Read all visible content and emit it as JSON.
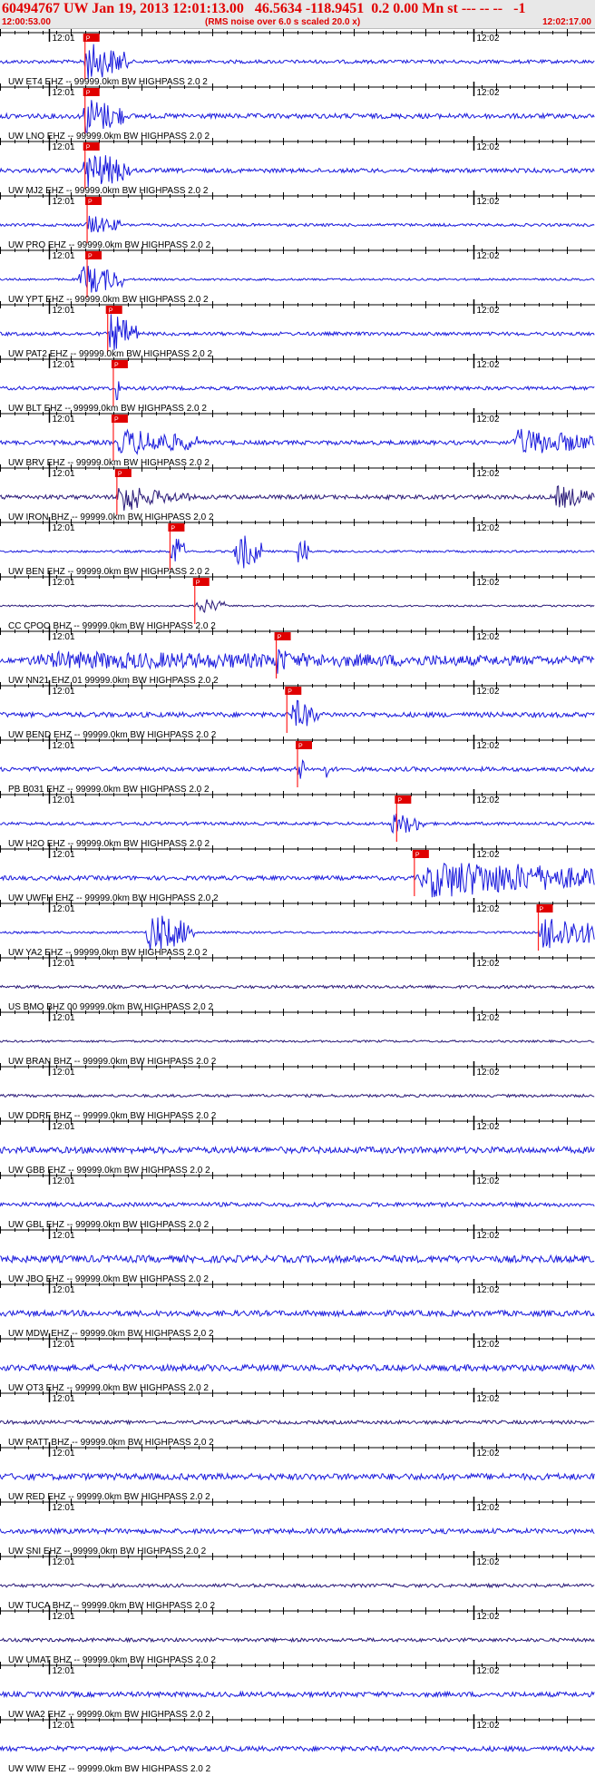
{
  "header": {
    "title": "60494767 UW Jan 19, 2013 12:01:13.00   46.5634 -118.9451  0.2 0.00 Mn st --- -- --   -1",
    "start_time": "12:00:53.00",
    "note": "(RMS noise over 6.0 s scaled 20.0 x)",
    "end_time": "12:02:17.00"
  },
  "chart_data": {
    "type": "seismogram",
    "time_window": {
      "start": "12:00:53.00",
      "end": "12:02:17.00"
    },
    "time_ticks": [
      "12:01",
      "12:02"
    ],
    "pick_label": "P",
    "traces": [
      {
        "label": "UW ET4 EHZ -- 99999.0km BW  HIGHPASS  2.0  2",
        "pick": 12.0,
        "color": "#1a1adc",
        "noise": 0.25,
        "bursts": [
          [
            11.5,
            18.0,
            1.0
          ]
        ]
      },
      {
        "label": "UW LNO EHZ -- 99999.0km BW  HIGHPASS  2.0  2",
        "pick": 12.0,
        "color": "#1a1adc",
        "noise": 0.35,
        "bursts": [
          [
            11.5,
            17.5,
            1.0
          ]
        ]
      },
      {
        "label": "UW MJ2 EHZ -- 99999.0km BW  HIGHPASS  2.0  2",
        "pick": 12.0,
        "color": "#1a1adc",
        "noise": 0.3,
        "bursts": [
          [
            11.5,
            18.5,
            1.0
          ]
        ]
      },
      {
        "label": "UW PRO EHZ -- 99999.0km BW  HIGHPASS  2.0  2",
        "pick": 12.3,
        "color": "#1a1adc",
        "noise": 0.2,
        "bursts": [
          [
            12.0,
            17.0,
            0.5
          ]
        ]
      },
      {
        "label": "UW YPT EHZ -- 99999.0km BW  HIGHPASS  2.0  2",
        "pick": 12.3,
        "color": "#1a1adc",
        "noise": 0.15,
        "bursts": [
          [
            11.0,
            17.5,
            0.8
          ]
        ]
      },
      {
        "label": "UW PAT2 EHZ -- 99999.0km BW  HIGHPASS  2.0  2",
        "pick": 15.2,
        "color": "#1a1adc",
        "noise": 0.25,
        "bursts": [
          [
            15.2,
            19.5,
            1.0
          ]
        ]
      },
      {
        "label": "UW BLT EHZ -- 99999.0km BW  HIGHPASS  2.0  2",
        "pick": 16.0,
        "color": "#1a1adc",
        "noise": 0.25,
        "bursts": [
          [
            16.3,
            17.0,
            1.0
          ]
        ]
      },
      {
        "label": "UW BRV EHZ -- 99999.0km BW  HIGHPASS  2.0  2",
        "pick": 16.0,
        "color": "#1a1adc",
        "noise": 0.3,
        "bursts": [
          [
            16.0,
            28.0,
            0.7
          ],
          [
            72.0,
            84.0,
            0.7
          ]
        ]
      },
      {
        "label": "UW IRON BHZ -- 99999.0km BW  HIGHPASS  2.0  2",
        "pick": 16.5,
        "color": "#2a1a78",
        "noise": 0.3,
        "bursts": [
          [
            16.5,
            20.0,
            1.0
          ],
          [
            20.0,
            27.0,
            0.4
          ],
          [
            78.0,
            84.0,
            0.6
          ]
        ]
      },
      {
        "label": "UW BEN EHZ -- 99999.0km BW  HIGHPASS  2.0  2",
        "pick": 24.0,
        "color": "#1a1adc",
        "noise": 0.15,
        "bursts": [
          [
            24.0,
            26.0,
            1.0
          ],
          [
            33.0,
            37.0,
            1.0
          ],
          [
            42.0,
            43.5,
            1.0
          ]
        ]
      },
      {
        "label": "CC CPOO BHZ -- 99999.0km BW  HIGHPASS  2.0  2",
        "pick": 27.5,
        "color": "#2a1a78",
        "noise": 0.12,
        "bursts": [
          [
            27.5,
            32.0,
            0.4
          ]
        ]
      },
      {
        "label": "UW NN21 EHZ 01 99999.0km BW  HIGHPASS  2.0  2",
        "pick": 39.0,
        "color": "#1a1adc",
        "noise": 0.3,
        "bursts": [
          [
            0.0,
            84.0,
            0.45
          ],
          [
            39.0,
            41.0,
            0.8
          ]
        ]
      },
      {
        "label": "UW BEND EHZ -- 99999.0km BW  HIGHPASS  2.0  2",
        "pick": 40.5,
        "color": "#1a1adc",
        "noise": 0.35,
        "bursts": [
          [
            41.0,
            45.0,
            0.8
          ]
        ]
      },
      {
        "label": "PB B031 EHZ -- 99999.0km BW  HIGHPASS  2.0  2",
        "pick": 42.0,
        "color": "#1a1adc",
        "noise": 0.3,
        "bursts": [
          [
            42.0,
            43.0,
            1.0
          ],
          [
            46.0,
            46.5,
            0.8
          ]
        ]
      },
      {
        "label": "UW H2O EHZ -- 99999.0km BW  HIGHPASS  2.0  2",
        "pick": 56.0,
        "color": "#1a1adc",
        "noise": 0.22,
        "bursts": [
          [
            55.0,
            60.0,
            0.6
          ]
        ]
      },
      {
        "label": "UW UWFH EHZ -- 99999.0km BW  HIGHPASS  2.0  2",
        "pick": 58.5,
        "color": "#1a1adc",
        "noise": 0.3,
        "bursts": [
          [
            58.5,
            84.0,
            1.0
          ]
        ]
      },
      {
        "label": "UW YA2 EHZ -- 99999.0km BW  HIGHPASS  2.0  2",
        "pick": 76.0,
        "color": "#1a1adc",
        "noise": 0.15,
        "bursts": [
          [
            20.5,
            27.5,
            1.0
          ],
          [
            76.0,
            84.0,
            1.0
          ]
        ]
      },
      {
        "label": "US BMO BHZ 00 99999.0km BW  HIGHPASS  2.0  2",
        "pick": null,
        "color": "#2a1a78",
        "noise": 0.22,
        "bursts": []
      },
      {
        "label": "UW BRAN BHZ -- 99999.0km BW  HIGHPASS  2.0  2",
        "pick": null,
        "color": "#2a1a78",
        "noise": 0.15,
        "bursts": []
      },
      {
        "label": "UW DDRF BHZ -- 99999.0km BW  HIGHPASS  2.0  2",
        "pick": null,
        "color": "#2a1a78",
        "noise": 0.2,
        "bursts": []
      },
      {
        "label": "UW GBB EHZ -- 99999.0km BW  HIGHPASS  2.0  2",
        "pick": null,
        "color": "#1a1adc",
        "noise": 0.45,
        "bursts": []
      },
      {
        "label": "UW GBL EHZ -- 99999.0km BW  HIGHPASS  2.0  2",
        "pick": null,
        "color": "#1a1adc",
        "noise": 0.3,
        "bursts": []
      },
      {
        "label": "UW JBO EHZ -- 99999.0km BW  HIGHPASS  2.0  2",
        "pick": null,
        "color": "#1a1adc",
        "noise": 0.5,
        "bursts": []
      },
      {
        "label": "UW MDW EHZ -- 99999.0km BW  HIGHPASS  2.0  2",
        "pick": null,
        "color": "#1a1adc",
        "noise": 0.4,
        "bursts": []
      },
      {
        "label": "UW OT3 EHZ -- 99999.0km BW  HIGHPASS  2.0  2",
        "pick": null,
        "color": "#1a1adc",
        "noise": 0.45,
        "bursts": []
      },
      {
        "label": "UW RATT BHZ -- 99999.0km BW  HIGHPASS  2.0  2",
        "pick": null,
        "color": "#2a1a78",
        "noise": 0.25,
        "bursts": []
      },
      {
        "label": "UW RED EHZ -- 99999.0km BW  HIGHPASS  2.0  2",
        "pick": null,
        "color": "#1a1adc",
        "noise": 0.45,
        "bursts": []
      },
      {
        "label": "UW SNI EHZ -- 99999.0km BW  HIGHPASS  2.0  2",
        "pick": null,
        "color": "#1a1adc",
        "noise": 0.35,
        "bursts": []
      },
      {
        "label": "UW TUCA BHZ -- 99999.0km BW  HIGHPASS  2.0  2",
        "pick": null,
        "color": "#2a1a78",
        "noise": 0.25,
        "bursts": []
      },
      {
        "label": "UW UMAT BHZ -- 99999.0km BW  HIGHPASS  2.0  2",
        "pick": null,
        "color": "#2a1a78",
        "noise": 0.25,
        "bursts": []
      },
      {
        "label": "UW WA2 EHZ -- 99999.0km BW  HIGHPASS  2.0  2",
        "pick": null,
        "color": "#1a1adc",
        "noise": 0.35,
        "bursts": []
      },
      {
        "label": "UW WIW EHZ -- 99999.0km BW  HIGHPASS  2.0  2",
        "pick": null,
        "color": "#1a1adc",
        "noise": 0.35,
        "bursts": []
      }
    ]
  }
}
